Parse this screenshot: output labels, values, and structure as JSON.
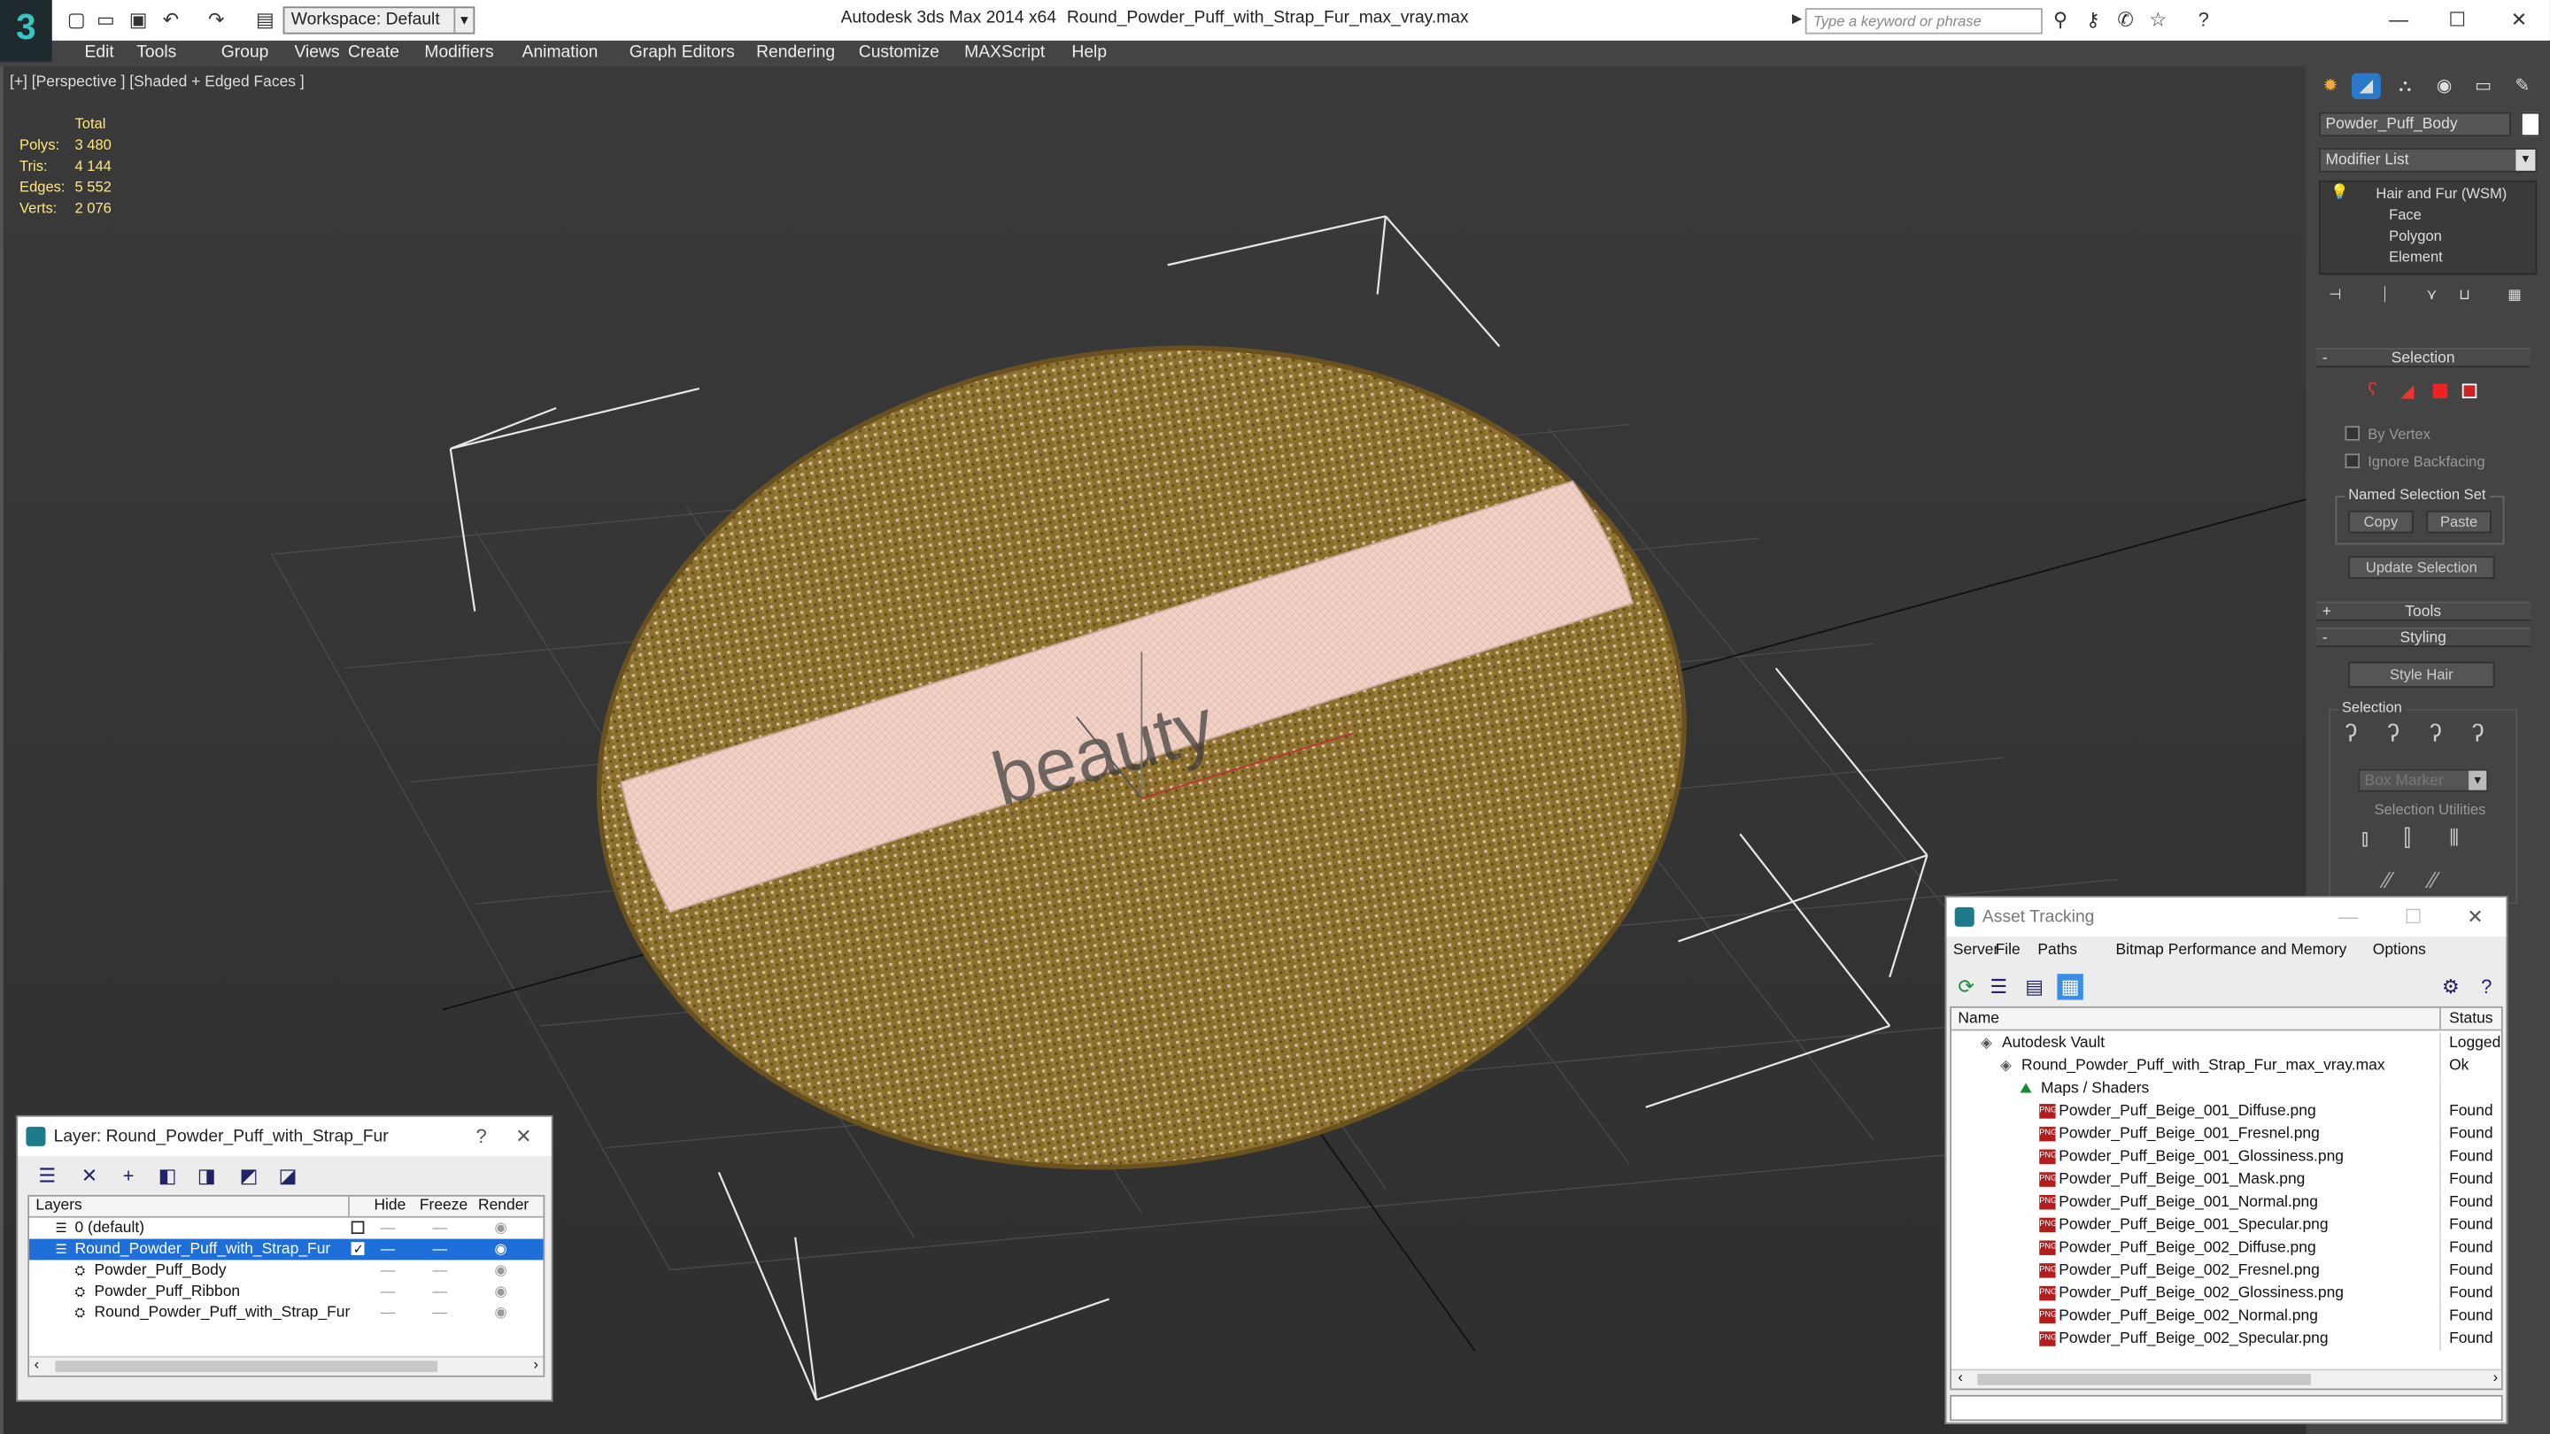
{
  "titlebar": {
    "workspace": "Workspace: Default",
    "app": "Autodesk 3ds Max 2014 x64",
    "file": "Round_Powder_Puff_with_Strap_Fur_max_vray.max",
    "search_placeholder": "Type a keyword or phrase"
  },
  "menu": [
    "Edit",
    "Tools",
    "Group",
    "Views",
    "Create",
    "Modifiers",
    "Animation",
    "Graph Editors",
    "Rendering",
    "Customize",
    "MAXScript",
    "Help"
  ],
  "viewport": {
    "label": "[+] [Perspective ] [Shaded + Edged Faces ]",
    "stats_header": "Total",
    "stats": [
      {
        "k": "Polys:",
        "v": "3 480"
      },
      {
        "k": "Tris:",
        "v": "4 144"
      },
      {
        "k": "Edges:",
        "v": "5 552"
      },
      {
        "k": "Verts:",
        "v": "2 076"
      }
    ],
    "strap_text": "beauty"
  },
  "command_panel": {
    "object_name": "Powder_Puff_Body",
    "modifier_list": "Modifier List",
    "stack": [
      "Hair and Fur (WSM)",
      "Face",
      "Polygon",
      "Element"
    ],
    "selection_title": "Selection",
    "by_vertex": "By Vertex",
    "ignore_backfacing": "Ignore Backfacing",
    "named_sel_set": "Named Selection Set",
    "copy": "Copy",
    "paste": "Paste",
    "update_selection": "Update Selection",
    "tools_title": "Tools",
    "styling_title": "Styling",
    "style_hair": "Style Hair",
    "styling_selection": "Selection",
    "box_marker": "Box Marker",
    "selection_utilities": "Selection Utilities"
  },
  "layer_panel": {
    "title": "Layer: Round_Powder_Puff_with_Strap_Fur",
    "help": "?",
    "close": "✕",
    "headers": [
      "Layers",
      "Hide",
      "Freeze",
      "Render"
    ],
    "rows": [
      {
        "name": "0 (default)",
        "indent": 0,
        "selected": false
      },
      {
        "name": "Round_Powder_Puff_with_Strap_Fur",
        "indent": 0,
        "selected": true
      },
      {
        "name": "Powder_Puff_Body",
        "indent": 1,
        "selected": false
      },
      {
        "name": "Powder_Puff_Ribbon",
        "indent": 1,
        "selected": false
      },
      {
        "name": "Round_Powder_Puff_with_Strap_Fur",
        "indent": 1,
        "selected": false
      }
    ]
  },
  "asset_panel": {
    "title": "Asset Tracking",
    "menu": [
      "Server",
      "File",
      "Paths",
      "Bitmap Performance and Memory",
      "Options"
    ],
    "headers": [
      "Name",
      "Status"
    ],
    "rows": [
      {
        "name": "Autodesk Vault",
        "status": "Logged",
        "indent": 1,
        "png": false
      },
      {
        "name": "Round_Powder_Puff_with_Strap_Fur_max_vray.max",
        "status": "Ok",
        "indent": 2,
        "png": false
      },
      {
        "name": "Maps / Shaders",
        "status": "",
        "indent": 3,
        "png": false
      },
      {
        "name": "Powder_Puff_Beige_001_Diffuse.png",
        "status": "Found",
        "indent": 4,
        "png": true
      },
      {
        "name": "Powder_Puff_Beige_001_Fresnel.png",
        "status": "Found",
        "indent": 4,
        "png": true
      },
      {
        "name": "Powder_Puff_Beige_001_Glossiness.png",
        "status": "Found",
        "indent": 4,
        "png": true
      },
      {
        "name": "Powder_Puff_Beige_001_Mask.png",
        "status": "Found",
        "indent": 4,
        "png": true
      },
      {
        "name": "Powder_Puff_Beige_001_Normal.png",
        "status": "Found",
        "indent": 4,
        "png": true
      },
      {
        "name": "Powder_Puff_Beige_001_Specular.png",
        "status": "Found",
        "indent": 4,
        "png": true
      },
      {
        "name": "Powder_Puff_Beige_002_Diffuse.png",
        "status": "Found",
        "indent": 4,
        "png": true
      },
      {
        "name": "Powder_Puff_Beige_002_Fresnel.png",
        "status": "Found",
        "indent": 4,
        "png": true
      },
      {
        "name": "Powder_Puff_Beige_002_Glossiness.png",
        "status": "Found",
        "indent": 4,
        "png": true
      },
      {
        "name": "Powder_Puff_Beige_002_Normal.png",
        "status": "Found",
        "indent": 4,
        "png": true
      },
      {
        "name": "Powder_Puff_Beige_002_Specular.png",
        "status": "Found",
        "indent": 4,
        "png": true
      }
    ]
  },
  "colors": {
    "accent": "#1e6fd9",
    "stats": "#ffe680",
    "fur": "#8a6f2e",
    "strap": "#f1d2c6"
  }
}
